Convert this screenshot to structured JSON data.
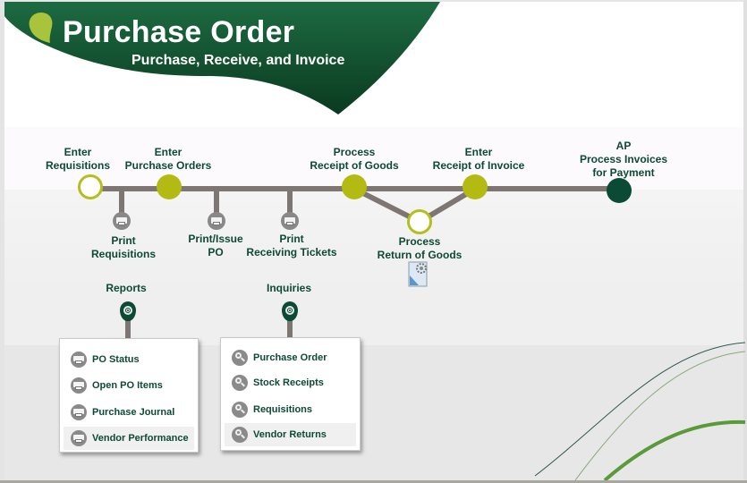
{
  "header": {
    "title": "Purchase Order",
    "subtitle": "Purchase, Receive, and Invoice",
    "logo_icon": "green-leaf-icon",
    "colors": {
      "banner": "#1a5e3a",
      "banner_dark": "#0b3f22",
      "leaf": "#a8c43c"
    }
  },
  "workflow": {
    "colors": {
      "line": "#7d7673",
      "node_olive": "#b3bb12",
      "node_dark": "#0b4a35",
      "text": "#0d4a34"
    },
    "nodes": [
      {
        "id": "enter-requisitions",
        "label_line1": "Enter",
        "label_line2": "Requisitions",
        "style": "hollow"
      },
      {
        "id": "enter-purchase-orders",
        "label_line1": "Enter",
        "label_line2": "Purchase Orders",
        "style": "filled"
      },
      {
        "id": "process-receipt-of-goods",
        "label_line1": "Process",
        "label_line2": "Receipt of Goods",
        "style": "filled"
      },
      {
        "id": "process-return-of-goods",
        "label_line1": "Process",
        "label_line2": "Return of Goods",
        "style": "hollow"
      },
      {
        "id": "enter-receipt-of-invoice",
        "label_line1": "Enter",
        "label_line2": "Receipt of Invoice",
        "style": "filled"
      },
      {
        "id": "ap-process-invoices",
        "label_line1": "AP",
        "label_line2": "Process Invoices",
        "label_line3": "for Payment",
        "style": "dark"
      }
    ],
    "print_actions": [
      {
        "id": "print-requisitions",
        "label_line1": "Print",
        "label_line2": "Requisitions",
        "icon": "printer-icon"
      },
      {
        "id": "print-issue-po",
        "label_line1": "Print/Issue",
        "label_line2": "PO",
        "icon": "printer-icon"
      },
      {
        "id": "print-receiving-tickets",
        "label_line1": "Print",
        "label_line2": "Receiving Tickets",
        "icon": "printer-icon"
      }
    ],
    "return_goods_icon": "document-gear-icon"
  },
  "reports": {
    "label": "Reports",
    "icon": "target-pin-icon",
    "items": [
      {
        "label": "PO Status",
        "icon": "printer-icon"
      },
      {
        "label": "Open PO Items",
        "icon": "printer-icon"
      },
      {
        "label": "Purchase Journal",
        "icon": "printer-icon"
      },
      {
        "label": "Vendor Performance",
        "icon": "printer-icon"
      }
    ]
  },
  "inquiries": {
    "label": "Inquiries",
    "icon": "target-pin-icon",
    "items": [
      {
        "label": "Purchase Order",
        "icon": "magnifier-icon"
      },
      {
        "label": "Stock Receipts",
        "icon": "magnifier-icon"
      },
      {
        "label": "Requisitions",
        "icon": "magnifier-icon"
      },
      {
        "label": "Vendor Returns",
        "icon": "magnifier-icon"
      }
    ]
  }
}
